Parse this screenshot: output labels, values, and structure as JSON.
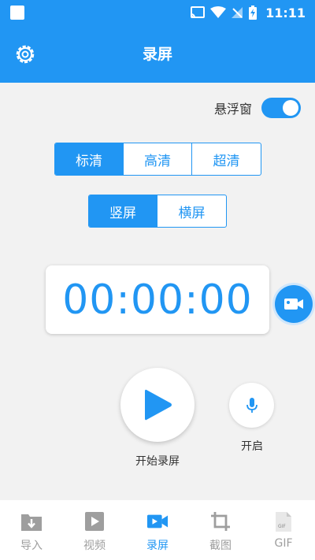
{
  "status": {
    "time": "11:11"
  },
  "appbar": {
    "title": "录屏"
  },
  "floating_window": {
    "label": "悬浮窗",
    "enabled": true
  },
  "quality": {
    "options": [
      "标清",
      "高清",
      "超清"
    ],
    "selected": "标清"
  },
  "orientation": {
    "options": [
      "竖屏",
      "横屏"
    ],
    "selected": "竖屏"
  },
  "timer": {
    "value": "00:00:00"
  },
  "record": {
    "start_label": "开始录屏"
  },
  "mic": {
    "label": "开启"
  },
  "nav": {
    "items": [
      {
        "label": "导入",
        "icon": "import-icon"
      },
      {
        "label": "视频",
        "icon": "video-play-icon"
      },
      {
        "label": "录屏",
        "icon": "record-camera-icon"
      },
      {
        "label": "截图",
        "icon": "crop-icon"
      },
      {
        "label": "GIF",
        "icon": "gif-file-icon"
      }
    ],
    "active": "录屏"
  },
  "colors": {
    "primary": "#2196f3",
    "background": "#f2f2f2",
    "inactive": "#9e9e9e"
  }
}
